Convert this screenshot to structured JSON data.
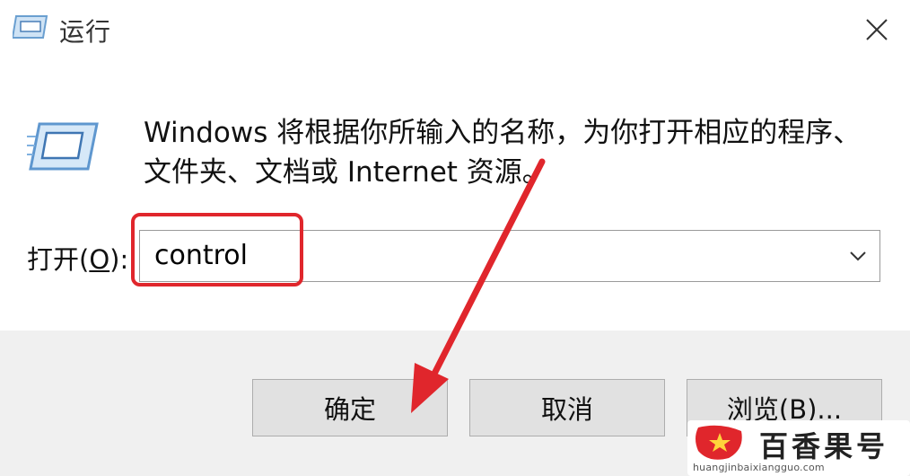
{
  "window": {
    "title": "运行",
    "close_icon": "close-icon"
  },
  "dialog": {
    "description": "Windows 将根据你所输入的名称，为你打开相应的程序、文件夹、文档或 Internet 资源。",
    "open_label_prefix": "打开(",
    "open_label_accel": "O",
    "open_label_suffix": "):",
    "input_value": "control"
  },
  "buttons": {
    "ok_label": "确定",
    "cancel_label": "取消",
    "browse_label": "浏览(B)..."
  },
  "annotations": {
    "highlight_color": "#e0262c",
    "arrow_color": "#e0262c"
  },
  "watermark": {
    "name": "百香果号",
    "url": "huangjinbaixiangguo.com",
    "logo_color": "#e0262c"
  }
}
